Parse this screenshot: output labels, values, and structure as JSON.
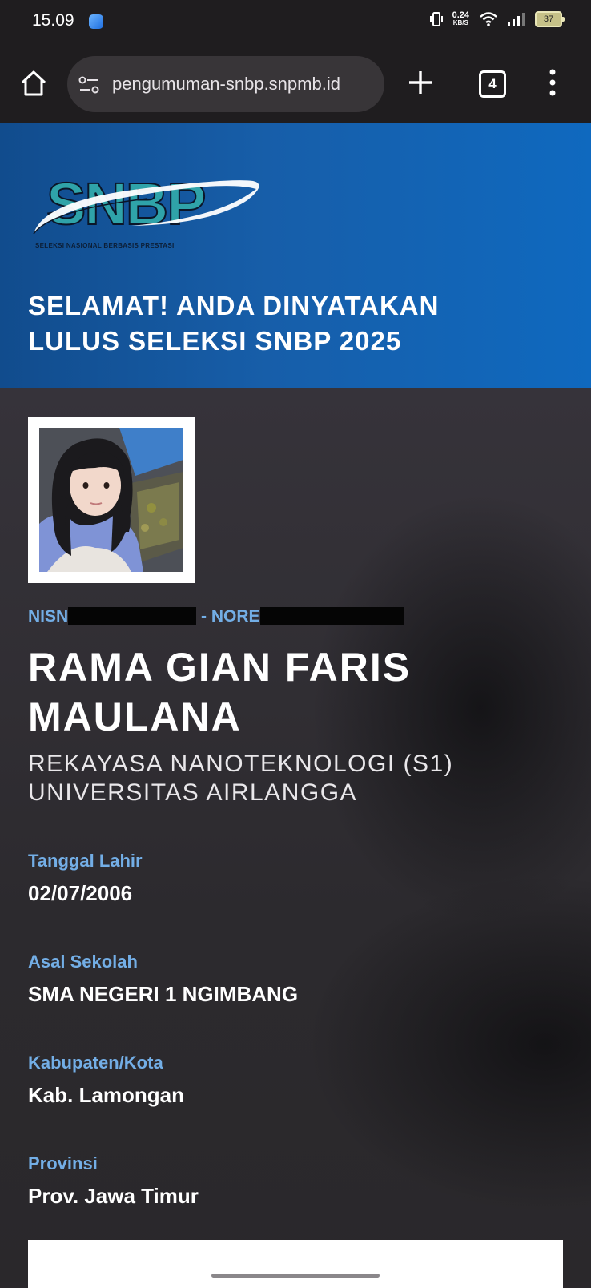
{
  "status_bar": {
    "time": "15.09",
    "net_speed": "0.24",
    "net_speed_unit": "KB/S",
    "battery": "37"
  },
  "browser": {
    "url": "pengumuman-snbp.snpmb.id",
    "tab_count": "4"
  },
  "header": {
    "logo_text": "SNBP",
    "logo_tagline": "SELEKSI NASIONAL BERBASIS PRESTASI",
    "headline_line1": "SELAMAT! ANDA DINYATAKAN",
    "headline_line2": "LULUS SELEKSI SNBP 2025"
  },
  "student": {
    "nisn_label": "NISN",
    "separator": "-",
    "nore_label": "NORE",
    "name_line1": "RAMA GIAN FARIS",
    "name_line2": "MAULANA",
    "program": "REKAYASA NANOTEKNOLOGI (S1)",
    "university": "UNIVERSITAS AIRLANGGA"
  },
  "fields": [
    {
      "label": "Tanggal Lahir",
      "value": "02/07/2006"
    },
    {
      "label": "Asal Sekolah",
      "value": "SMA NEGERI 1 NGIMBANG"
    },
    {
      "label": "Kabupaten/Kota",
      "value": "Kab. Lamongan"
    },
    {
      "label": "Provinsi",
      "value": "Prov. Jawa Timur"
    }
  ],
  "colors": {
    "banner": "#175ea9",
    "label": "#73aee6",
    "logo_teal": "#2fa3a9",
    "page_bg": "#2b282c"
  }
}
